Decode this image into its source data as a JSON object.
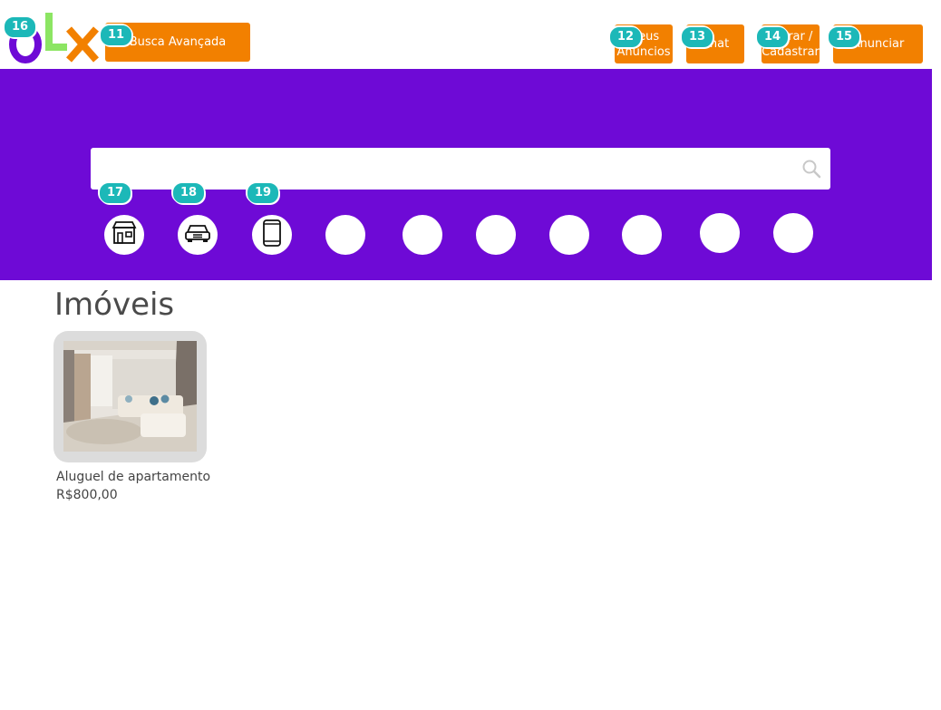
{
  "header": {
    "logo_letters": "OLX",
    "buttons": {
      "busca_avancada": "Busca Avançada",
      "meus_anuncios": "Meus Anúncios",
      "chat": "Chat",
      "entrar_cadastrar": "Entrar / Cadastrar",
      "anunciar": "Anunciar"
    }
  },
  "badges": {
    "b11": "11",
    "b12": "12",
    "b13": "13",
    "b14": "14",
    "b15": "15",
    "b16": "16",
    "b17": "17",
    "b18": "18",
    "b19": "19"
  },
  "search": {
    "placeholder": "",
    "value": ""
  },
  "categories": [
    {
      "icon": "store-icon"
    },
    {
      "icon": "car-icon"
    },
    {
      "icon": "phone-icon"
    },
    {
      "icon": ""
    },
    {
      "icon": ""
    },
    {
      "icon": ""
    },
    {
      "icon": ""
    },
    {
      "icon": ""
    },
    {
      "icon": ""
    },
    {
      "icon": ""
    }
  ],
  "section": {
    "title": "Imóveis"
  },
  "listing": {
    "title": "Aluguel de apartamento",
    "price": "R$800,00"
  },
  "colors": {
    "purple": "#6e0ad6",
    "orange": "#f28000",
    "badge": "#1cb8b8"
  }
}
